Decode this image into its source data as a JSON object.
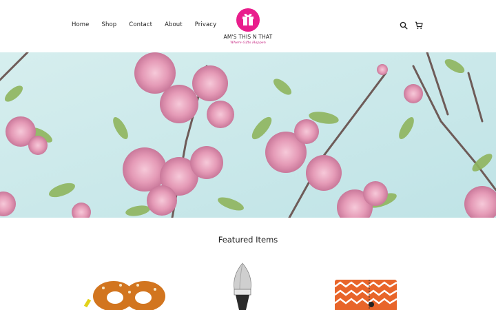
{
  "nav": {
    "items": [
      {
        "label": "Home"
      },
      {
        "label": "Shop"
      },
      {
        "label": "Contact"
      },
      {
        "label": "About"
      },
      {
        "label": "Privacy"
      }
    ]
  },
  "brand": {
    "name": "AM'S THIS N THAT",
    "tagline": "Where Gifts Happen",
    "color": "#e91e8c"
  },
  "header_icons": [
    "search-icon",
    "cart-icon"
  ],
  "hero": {
    "image": "cherry-blossom-branches",
    "sky_color": "#cfe9ea",
    "blossom_color": "#e9a3bd"
  },
  "featured": {
    "title": "Featured Items",
    "products": [
      {
        "image": "pretzel-bag"
      },
      {
        "image": "makeup-brush"
      },
      {
        "image": "orange-chevron-pillow"
      }
    ]
  }
}
